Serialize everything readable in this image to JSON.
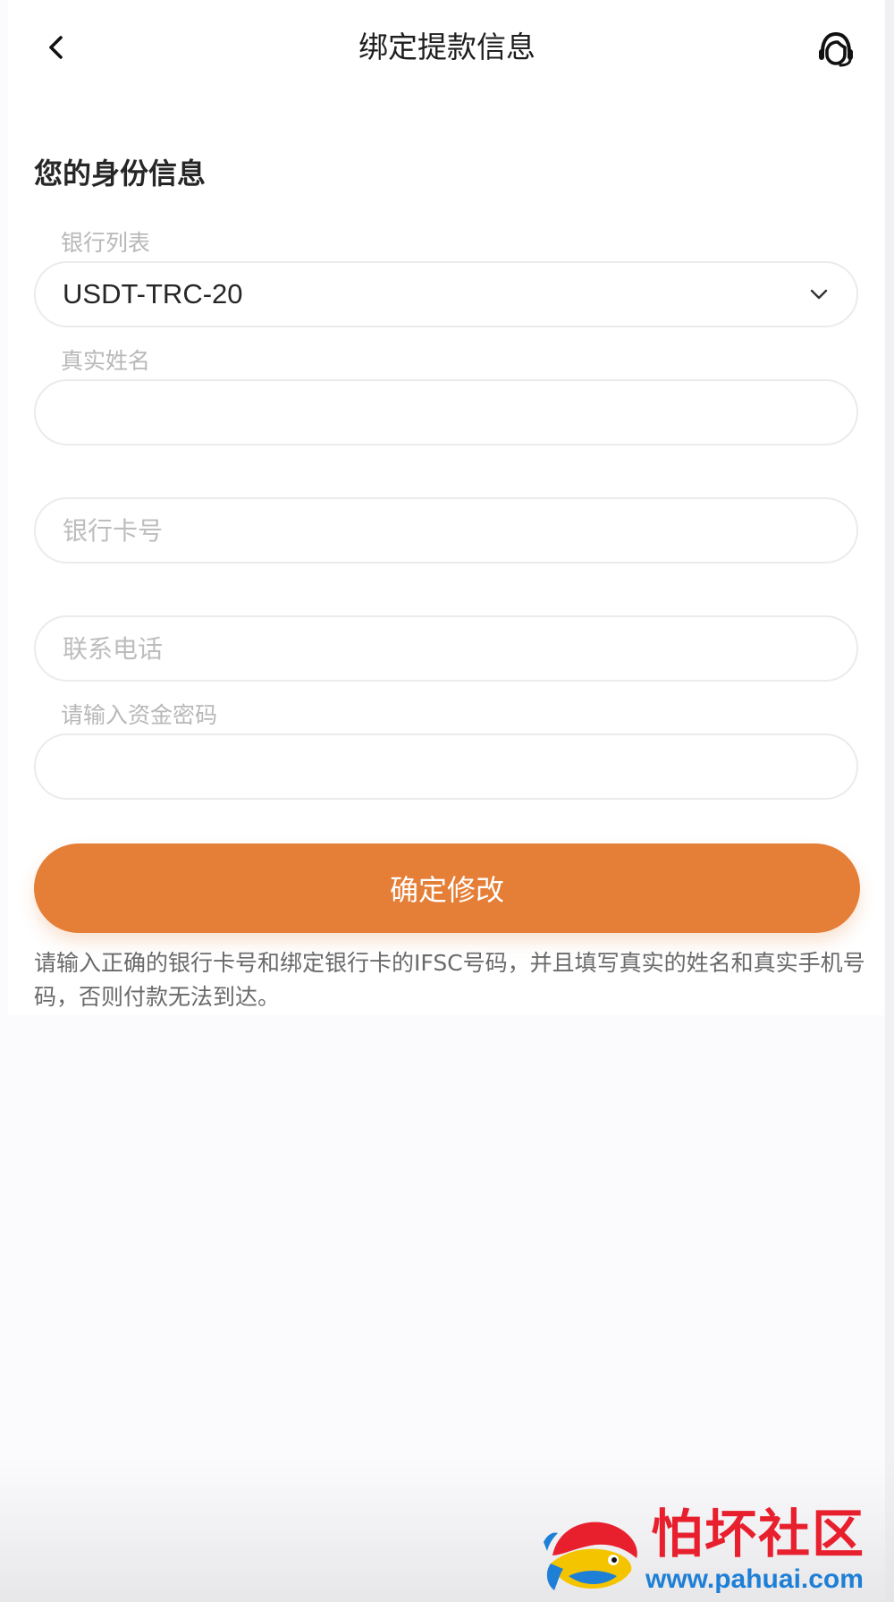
{
  "header": {
    "title": "绑定提款信息",
    "back_icon": "chevron-left-icon",
    "support_icon": "customer-service-icon"
  },
  "section": {
    "title": "您的身份信息"
  },
  "form": {
    "bank": {
      "label": "银行列表",
      "selected": "USDT-TRC-20"
    },
    "real_name": {
      "label": "真实姓名",
      "value": ""
    },
    "card_number": {
      "placeholder": "银行卡号",
      "value": ""
    },
    "phone": {
      "placeholder": "联系电话",
      "value": ""
    },
    "fund_password": {
      "label": "请输入资金密码",
      "value": ""
    }
  },
  "actions": {
    "confirm_label": "确定修改"
  },
  "notice": "请输入正确的银行卡号和绑定银行卡的IFSC号码，并且填写真实的姓名和真实手机号码，否则付款无法到达。",
  "watermark": {
    "title": "怕坏社区",
    "url": "www.pahuai.com"
  },
  "colors": {
    "accent": "#e57e36",
    "watermark_red": "#e8202e",
    "watermark_blue": "#1e7fd6"
  }
}
